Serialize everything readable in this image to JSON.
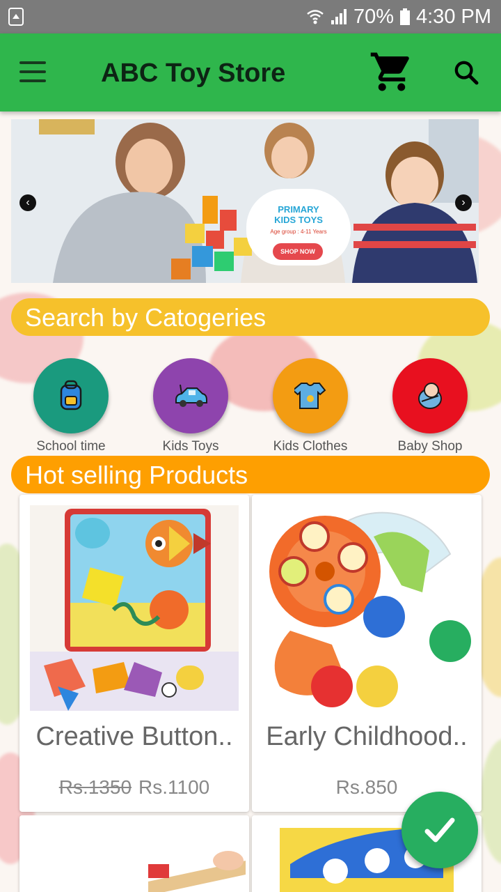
{
  "status_bar": {
    "battery": "70%",
    "time": "4:30 PM"
  },
  "app_bar": {
    "title": "ABC Toy Store"
  },
  "banner": {
    "line1": "PRIMARY",
    "line2": "KIDS TOYS",
    "age_group": "Age group : 4-11 Years",
    "button": "SHOP NOW"
  },
  "categories_section": {
    "title": "Search by Catogeries",
    "items": [
      {
        "label": "School time",
        "color": "#1a9a7e",
        "icon": "backpack-icon"
      },
      {
        "label": "Kids Toys",
        "color": "#8e44ad",
        "icon": "toy-car-icon"
      },
      {
        "label": "Kids Clothes",
        "color": "#f39c12",
        "icon": "baby-clothes-icon"
      },
      {
        "label": "Baby Shop",
        "color": "#e8101f",
        "icon": "baby-icon"
      }
    ]
  },
  "hot_section": {
    "title": "Hot selling Products",
    "products": [
      {
        "name": "Creative Button..",
        "old_price": "Rs.1350",
        "price": "Rs.1100"
      },
      {
        "name": "Early Childhood..",
        "old_price": "",
        "price": "Rs.850"
      }
    ]
  },
  "colors": {
    "app_bar": "#2fb64c",
    "categories_header": "#f6c12b",
    "hot_header": "#fe9f01",
    "fab": "#27ae60"
  }
}
